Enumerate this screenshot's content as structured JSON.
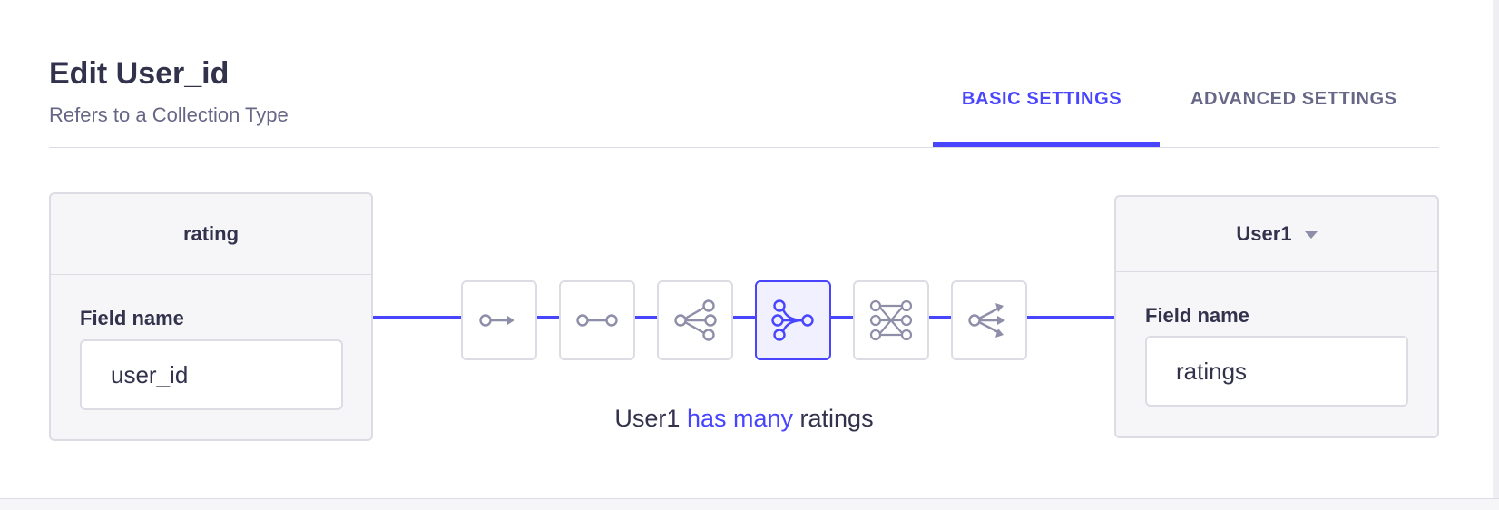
{
  "header": {
    "title": "Edit User_id",
    "subtitle": "Refers to a Collection Type"
  },
  "tabs": [
    {
      "label": "BASIC SETTINGS",
      "active": true
    },
    {
      "label": "ADVANCED SETTINGS",
      "active": false
    }
  ],
  "left_card": {
    "header": "rating",
    "field_label": "Field name",
    "field_value": "user_id"
  },
  "right_card": {
    "header": "User1",
    "field_label": "Field name",
    "field_value": "ratings"
  },
  "relations": [
    {
      "icon": "one-way-icon",
      "active": false
    },
    {
      "icon": "one-to-one-icon",
      "active": false
    },
    {
      "icon": "one-to-many-icon",
      "active": false
    },
    {
      "icon": "many-to-one-icon",
      "active": true
    },
    {
      "icon": "many-to-many-icon",
      "active": false
    },
    {
      "icon": "many-way-icon",
      "active": false
    }
  ],
  "sentence": {
    "subject": "User1",
    "relation": "has many",
    "object": "ratings"
  },
  "colors": {
    "accent": "#4945ff",
    "icon_gray": "#8e8ea9",
    "text": "#32324d",
    "muted": "#666687",
    "border": "#dcdce4",
    "panel": "#f6f6f9"
  }
}
